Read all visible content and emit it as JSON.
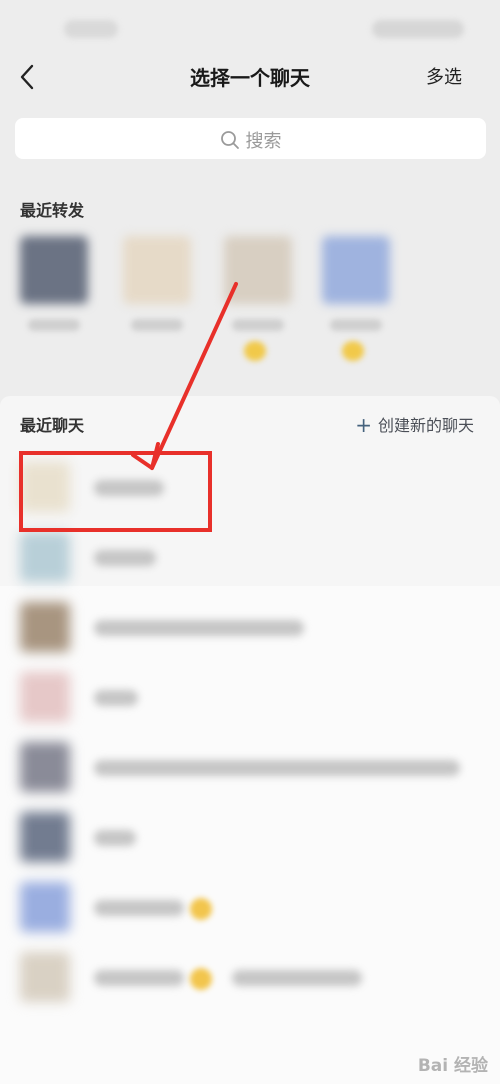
{
  "header": {
    "title": "选择一个聊天",
    "multi_select_label": "多选"
  },
  "search": {
    "placeholder": "搜索"
  },
  "recent_forward": {
    "label": "最近转发"
  },
  "recent_chats": {
    "label": "最近聊天",
    "create_new_label": "创建新的聊天"
  },
  "watermark": {
    "text": "Bai 经验"
  },
  "colors": {
    "highlight_red": "#e8302a",
    "background": "#ededed"
  }
}
